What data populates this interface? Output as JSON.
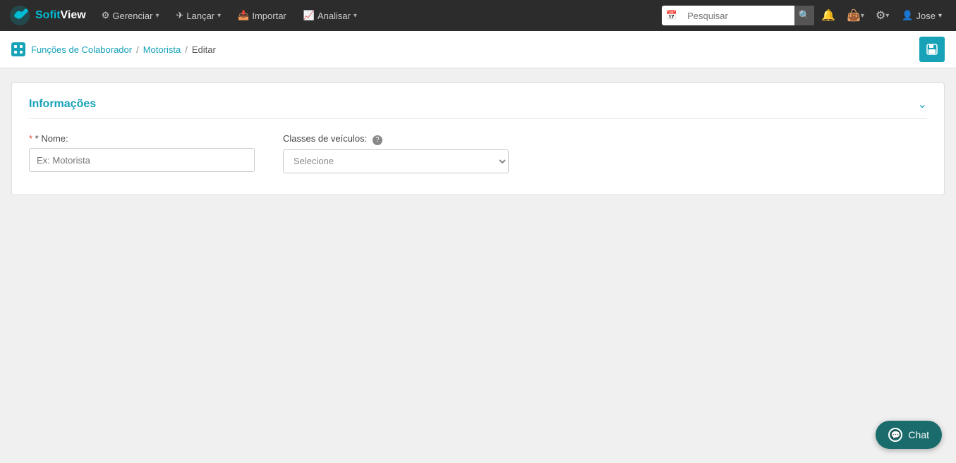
{
  "brand": {
    "sofit": "Sofit",
    "view": "View"
  },
  "navbar": {
    "items": [
      {
        "label": "Gerenciar",
        "icon": "⚙",
        "has_dropdown": true
      },
      {
        "label": "Lançar",
        "icon": "✈",
        "has_dropdown": true
      },
      {
        "label": "Importar",
        "icon": "📥",
        "has_dropdown": false
      },
      {
        "label": "Analisar",
        "icon": "📈",
        "has_dropdown": true
      }
    ],
    "search_placeholder": "Pesquisar",
    "user_name": "Jose"
  },
  "breadcrumb": {
    "icon_label": "grid-icon",
    "link1": "Funções de Colaborador",
    "link2": "Motorista",
    "current": "Editar"
  },
  "form": {
    "section_title": "Informações",
    "nome_label": "* Nome:",
    "nome_placeholder": "Ex: Motorista",
    "classes_label": "Classes de veículos:",
    "classes_placeholder": "Selecione",
    "classes_options": [
      "Selecione"
    ]
  },
  "chat": {
    "label": "Chat"
  },
  "colors": {
    "brand": "#17a2b8",
    "navbar_bg": "#2c2c2c",
    "chat_bg": "#1a6b6b"
  }
}
